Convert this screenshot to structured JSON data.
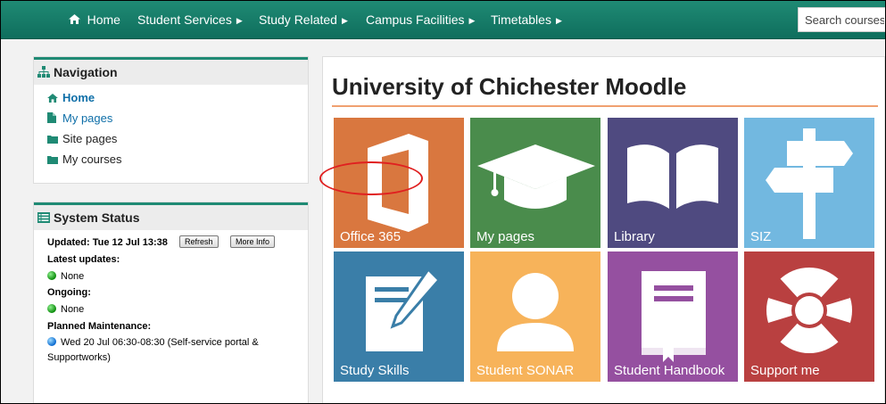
{
  "navbar": {
    "home": "Home",
    "items": [
      {
        "label": "Student Services"
      },
      {
        "label": "Study Related"
      },
      {
        "label": "Campus Facilities"
      },
      {
        "label": "Timetables"
      }
    ],
    "search_placeholder": "Search courses"
  },
  "navigation": {
    "title": "Navigation",
    "links": [
      {
        "label": "Home"
      },
      {
        "label": "My pages"
      },
      {
        "label": "Site pages"
      },
      {
        "label": "My courses"
      }
    ]
  },
  "system_status": {
    "title": "System Status",
    "updated": "Updated: Tue 12 Jul 13:38",
    "refresh_label": "Refresh",
    "more_info_label": "More Info",
    "latest_updates_label": "Latest updates:",
    "latest_updates_value": "None",
    "ongoing_label": "Ongoing:",
    "ongoing_value": "None",
    "planned_label": "Planned Maintenance:",
    "planned_line1": "Wed 20 Jul 06:30-08:30 (Self-service portal &",
    "planned_line2": "Supportworks)"
  },
  "main": {
    "title": "University of Chichester Moodle",
    "tiles": [
      {
        "label": "Office 365",
        "color": "#d9773f",
        "icon": "office-icon"
      },
      {
        "label": "My pages",
        "color": "#4a8c4c",
        "icon": "graduation-cap-icon"
      },
      {
        "label": "Library",
        "color": "#4f4a80",
        "icon": "book-icon"
      },
      {
        "label": "SIZ",
        "color": "#72b8e0",
        "icon": "signpost-icon"
      },
      {
        "label": "Study Skills",
        "color": "#3a7ea8",
        "icon": "pencil-paper-icon"
      },
      {
        "label": "Student SONAR",
        "color": "#f7b35a",
        "icon": "person-icon"
      },
      {
        "label": "Student Handbook",
        "color": "#9550a0",
        "icon": "handbook-icon"
      },
      {
        "label": "Support me",
        "color": "#b94040",
        "icon": "lifebuoy-icon"
      }
    ]
  },
  "colors": {
    "navbar": "#1f8a74",
    "link": "#0f6fa8",
    "accent_rule": "#f0a070",
    "highlight": "#e02020"
  }
}
